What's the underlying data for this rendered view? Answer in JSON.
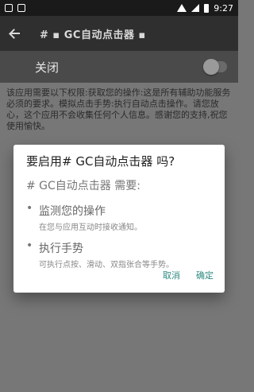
{
  "status_bar": {
    "left_icons": [
      "square-icon",
      "notification-icon"
    ],
    "right_icons": [
      "wifi-icon",
      "signal-icon",
      "battery-icon"
    ],
    "time": "9:27"
  },
  "toolbar": {
    "title": "# ▪ GC自动点击器 ▪"
  },
  "toggle_row": {
    "label": "关闭",
    "checked": false
  },
  "description": {
    "text": "该应用需要以下权限:获取您的操作:这是所有辅助功能服务必须的要求。模拟点击手势:执行自动点击操作。请您放心，这个应用不会收集任何个人信息。感谢您的支持,祝您使用愉快。"
  },
  "dialog": {
    "title": "要启用#    GC自动点击器    吗?",
    "subtitle": "#    GC自动点击器    需要:",
    "permissions": [
      {
        "title": "监测您的操作",
        "description": "在您与应用互动时接收通知。"
      },
      {
        "title": "执行手势",
        "description": "可执行点按、滑动、双指张合等手势。"
      }
    ],
    "cancel_label": "取消",
    "ok_label": "确定",
    "accent_color": "#2e8b82"
  }
}
